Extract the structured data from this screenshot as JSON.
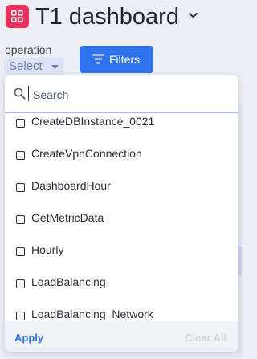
{
  "header": {
    "title": "T1 dashboard",
    "app_icon": "grid-apps-icon",
    "title_menu_icon": "chevron-down-icon",
    "accent_color": "#e8315c"
  },
  "filter": {
    "label": "operation",
    "select_value": "Select",
    "filters_button": "Filters",
    "filters_icon": "filter-funnel-icon",
    "button_color": "#2f73ee"
  },
  "dropdown": {
    "search_placeholder": "Search",
    "search_icon": "search-icon",
    "options": [
      {
        "label": "CreateDBInstance_0021",
        "checked": false
      },
      {
        "label": "CreateVpnConnection",
        "checked": false
      },
      {
        "label": "DashboardHour",
        "checked": false
      },
      {
        "label": "GetMetricData",
        "checked": false
      },
      {
        "label": "Hourly",
        "checked": false
      },
      {
        "label": "LoadBalancing",
        "checked": false
      },
      {
        "label": "LoadBalancing_Network",
        "checked": false
      }
    ],
    "apply_label": "Apply",
    "clear_all_label": "Clear All"
  }
}
